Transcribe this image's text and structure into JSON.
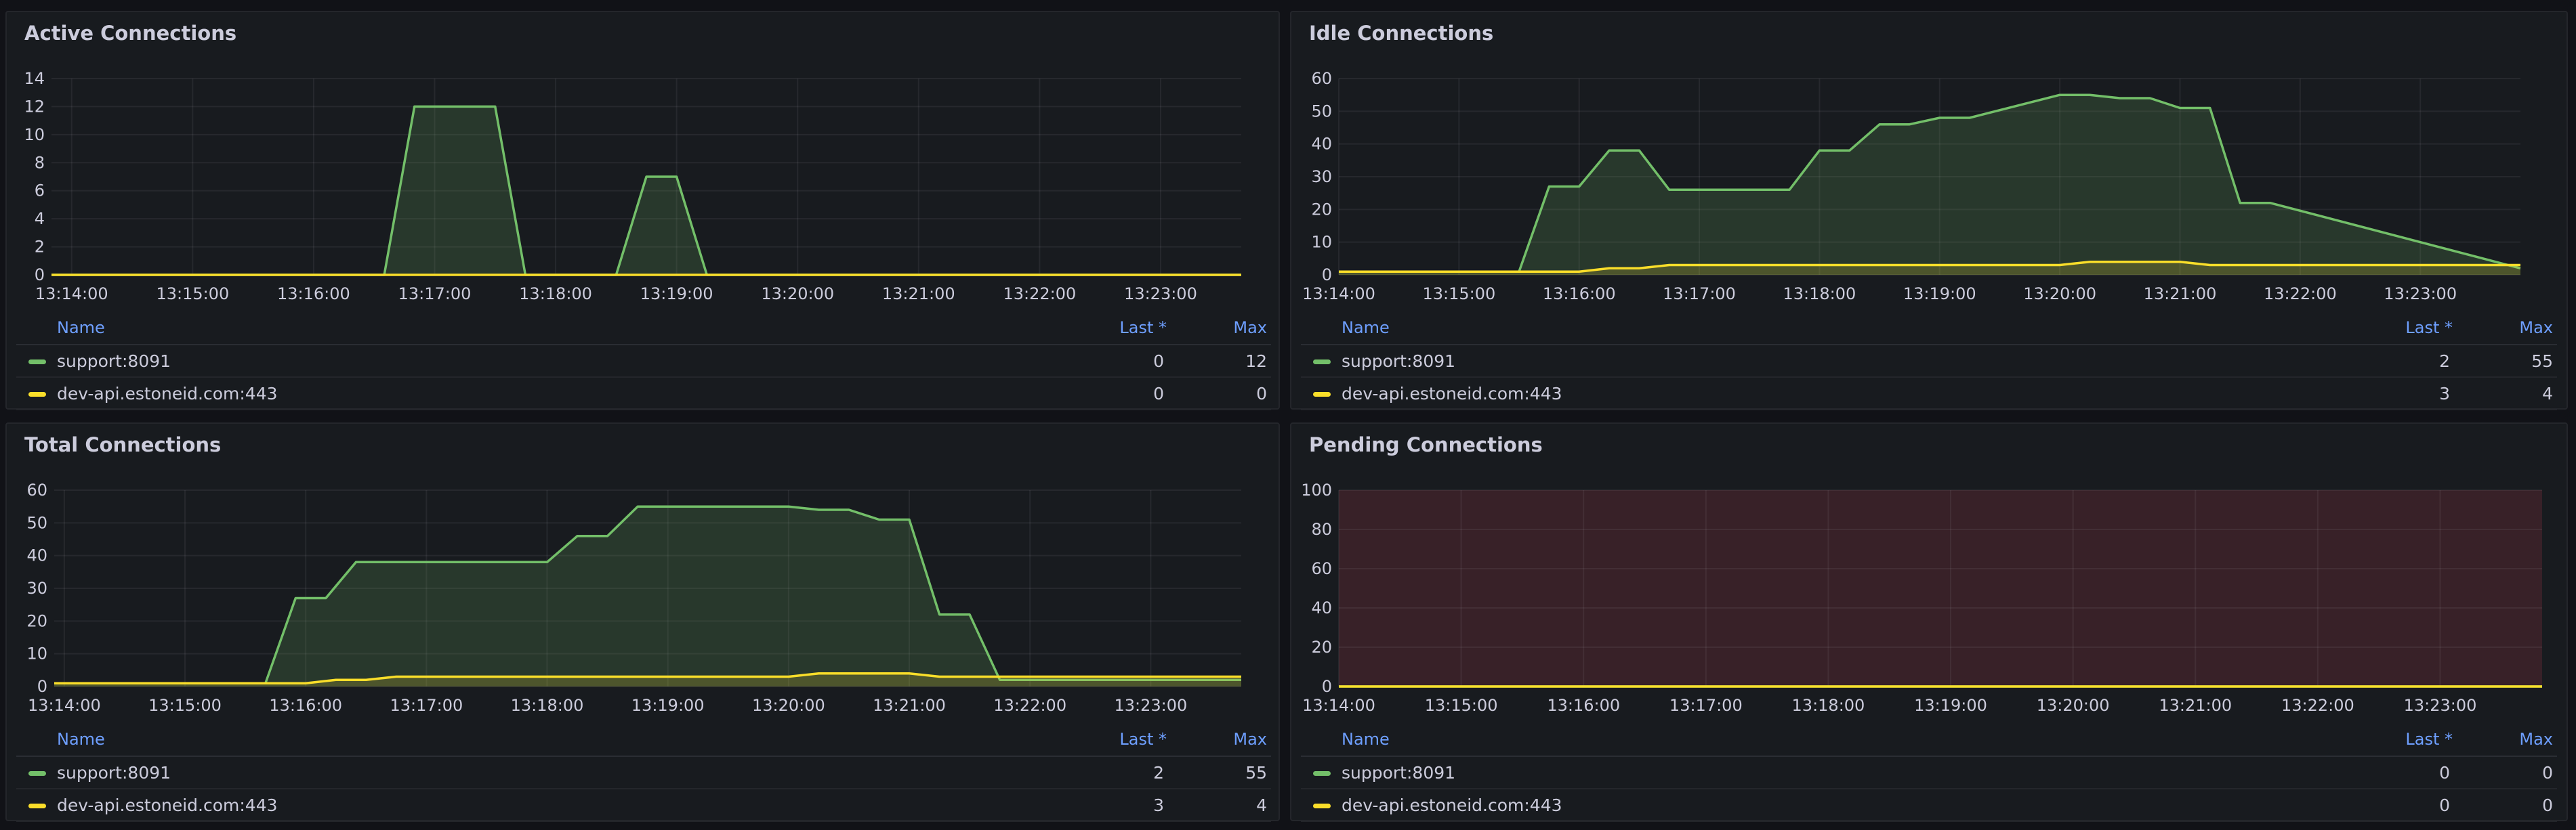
{
  "colors": {
    "support": "#73bf69",
    "devapi": "#fade2a",
    "threshold": "#f2495c"
  },
  "legend_headers": {
    "name": "Name",
    "last": "Last *",
    "max": "Max"
  },
  "panels": [
    {
      "title": "Active Connections",
      "legend": [
        {
          "name": "support:8091",
          "last": "0",
          "max": "12"
        },
        {
          "name": "dev-api.estoneid.com:443",
          "last": "0",
          "max": "0"
        }
      ]
    },
    {
      "title": "Idle Connections",
      "legend": [
        {
          "name": "support:8091",
          "last": "2",
          "max": "55"
        },
        {
          "name": "dev-api.estoneid.com:443",
          "last": "3",
          "max": "4"
        }
      ]
    },
    {
      "title": "Total Connections",
      "legend": [
        {
          "name": "support:8091",
          "last": "2",
          "max": "55"
        },
        {
          "name": "dev-api.estoneid.com:443",
          "last": "3",
          "max": "4"
        }
      ]
    },
    {
      "title": "Pending Connections",
      "legend": [
        {
          "name": "support:8091",
          "last": "0",
          "max": "0"
        },
        {
          "name": "dev-api.estoneid.com:443",
          "last": "0",
          "max": "0"
        }
      ]
    }
  ],
  "chart_data": [
    {
      "type": "area",
      "title": "Active Connections",
      "x_ticks": [
        "13:14:00",
        "13:15:00",
        "13:16:00",
        "13:17:00",
        "13:18:00",
        "13:19:00",
        "13:20:00",
        "13:21:00",
        "13:22:00",
        "13:23:00"
      ],
      "y_ticks": [
        0,
        2,
        4,
        6,
        8,
        10,
        12,
        14
      ],
      "ylim": [
        0,
        14
      ],
      "xlim": [
        "13:13:50",
        "13:23:40"
      ],
      "grid": true,
      "series": [
        {
          "name": "support:8091",
          "color": "#73bf69",
          "x": [
            "13:13:50",
            "13:16:35",
            "13:16:50",
            "13:17:30",
            "13:17:45",
            "13:18:30",
            "13:18:45",
            "13:19:00",
            "13:19:15",
            "13:23:40"
          ],
          "y": [
            0,
            0,
            12,
            12,
            0,
            0,
            7,
            7,
            0,
            0
          ]
        },
        {
          "name": "dev-api.estoneid.com:443",
          "color": "#fade2a",
          "x": [
            "13:13:50",
            "13:23:40"
          ],
          "y": [
            0,
            0
          ]
        }
      ]
    },
    {
      "type": "area",
      "title": "Idle Connections",
      "x_ticks": [
        "13:14:00",
        "13:15:00",
        "13:16:00",
        "13:17:00",
        "13:18:00",
        "13:19:00",
        "13:20:00",
        "13:21:00",
        "13:22:00",
        "13:23:00"
      ],
      "y_ticks": [
        0,
        10,
        20,
        30,
        40,
        50,
        60
      ],
      "ylim": [
        0,
        60
      ],
      "xlim": [
        "13:14:00",
        "13:23:50"
      ],
      "grid": true,
      "series": [
        {
          "name": "support:8091",
          "color": "#73bf69",
          "x": [
            "13:14:00",
            "13:15:30",
            "13:15:45",
            "13:16:00",
            "13:16:15",
            "13:16:30",
            "13:16:45",
            "13:17:30",
            "13:17:45",
            "13:18:00",
            "13:18:15",
            "13:18:30",
            "13:18:45",
            "13:19:00",
            "13:19:15",
            "13:20:00",
            "13:20:15",
            "13:20:30",
            "13:20:45",
            "13:21:00",
            "13:21:15",
            "13:21:30",
            "13:21:45",
            "13:23:50"
          ],
          "y": [
            1,
            1,
            27,
            27,
            38,
            38,
            26,
            26,
            26,
            38,
            38,
            46,
            46,
            48,
            48,
            55,
            55,
            54,
            54,
            51,
            51,
            22,
            22,
            2
          ]
        },
        {
          "name": "dev-api.estoneid.com:443",
          "color": "#fade2a",
          "x": [
            "13:14:00",
            "13:16:00",
            "13:16:15",
            "13:16:30",
            "13:16:45",
            "13:20:00",
            "13:20:15",
            "13:21:00",
            "13:21:15",
            "13:23:50"
          ],
          "y": [
            1,
            1,
            2,
            2,
            3,
            3,
            4,
            4,
            3,
            3
          ]
        }
      ]
    },
    {
      "type": "area",
      "title": "Total Connections",
      "x_ticks": [
        "13:14:00",
        "13:15:00",
        "13:16:00",
        "13:17:00",
        "13:18:00",
        "13:19:00",
        "13:20:00",
        "13:21:00",
        "13:22:00",
        "13:23:00"
      ],
      "y_ticks": [
        0,
        10,
        20,
        30,
        40,
        50,
        60
      ],
      "ylim": [
        0,
        60
      ],
      "xlim": [
        "13:13:55",
        "13:23:45"
      ],
      "grid": true,
      "series": [
        {
          "name": "support:8091",
          "color": "#73bf69",
          "x": [
            "13:13:55",
            "13:15:40",
            "13:15:55",
            "13:16:10",
            "13:16:25",
            "13:18:00",
            "13:18:15",
            "13:18:30",
            "13:18:45",
            "13:20:00",
            "13:20:15",
            "13:20:30",
            "13:20:45",
            "13:21:00",
            "13:21:15",
            "13:21:30",
            "13:21:45",
            "13:23:45"
          ],
          "y": [
            1,
            1,
            27,
            27,
            38,
            38,
            46,
            46,
            55,
            55,
            54,
            54,
            51,
            51,
            22,
            22,
            2,
            2
          ]
        },
        {
          "name": "dev-api.estoneid.com:443",
          "color": "#fade2a",
          "x": [
            "13:13:55",
            "13:16:00",
            "13:16:15",
            "13:16:30",
            "13:16:45",
            "13:20:00",
            "13:20:15",
            "13:21:00",
            "13:21:15",
            "13:23:45"
          ],
          "y": [
            1,
            1,
            2,
            2,
            3,
            3,
            4,
            4,
            3,
            3
          ]
        }
      ]
    },
    {
      "type": "area",
      "title": "Pending Connections",
      "x_ticks": [
        "13:14:00",
        "13:15:00",
        "13:16:00",
        "13:17:00",
        "13:18:00",
        "13:19:00",
        "13:20:00",
        "13:21:00",
        "13:22:00",
        "13:23:00"
      ],
      "y_ticks": [
        0,
        20,
        40,
        60,
        80,
        100
      ],
      "ylim": [
        0,
        100
      ],
      "xlim": [
        "13:14:00",
        "13:23:50"
      ],
      "grid": true,
      "threshold_region": {
        "from": 0,
        "to": 100,
        "color": "#f2495c"
      },
      "series": [
        {
          "name": "support:8091",
          "color": "#73bf69",
          "x": [
            "13:14:00",
            "13:23:50"
          ],
          "y": [
            0,
            0
          ]
        },
        {
          "name": "dev-api.estoneid.com:443",
          "color": "#fade2a",
          "x": [
            "13:14:00",
            "13:23:50"
          ],
          "y": [
            0,
            0
          ]
        }
      ]
    }
  ]
}
